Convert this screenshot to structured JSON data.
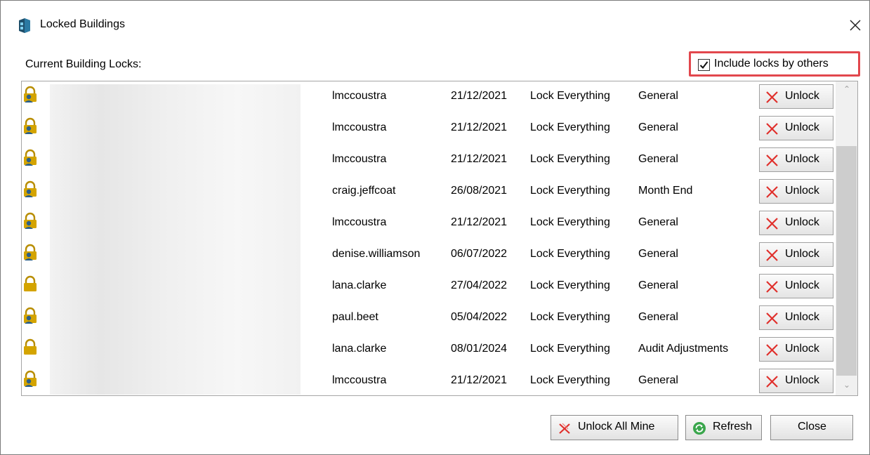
{
  "window": {
    "title": "Locked Buildings",
    "app_icon": "building-db-icon",
    "close_icon": "close-icon"
  },
  "section_label": "Current Building Locks:",
  "include_others": {
    "label": "Include locks by others",
    "checked": true,
    "highlight_color": "#e2474d"
  },
  "rows": [
    {
      "lock_icon": "lock-user-icon",
      "user": "lmccoustra",
      "date": "21/12/2021",
      "lock_type": "Lock Everything",
      "category": "General",
      "action": "Unlock"
    },
    {
      "lock_icon": "lock-user-icon",
      "user": "lmccoustra",
      "date": "21/12/2021",
      "lock_type": "Lock Everything",
      "category": "General",
      "action": "Unlock"
    },
    {
      "lock_icon": "lock-user-icon",
      "user": "lmccoustra",
      "date": "21/12/2021",
      "lock_type": "Lock Everything",
      "category": "General",
      "action": "Unlock"
    },
    {
      "lock_icon": "lock-user-icon",
      "user": "craig.jeffcoat",
      "date": "26/08/2021",
      "lock_type": "Lock Everything",
      "category": "Month End",
      "action": "Unlock"
    },
    {
      "lock_icon": "lock-user-icon",
      "user": "lmccoustra",
      "date": "21/12/2021",
      "lock_type": "Lock Everything",
      "category": "General",
      "action": "Unlock"
    },
    {
      "lock_icon": "lock-user-icon",
      "user": "denise.williamson",
      "date": "06/07/2022",
      "lock_type": "Lock Everything",
      "category": "General",
      "action": "Unlock"
    },
    {
      "lock_icon": "lock-icon",
      "user": "lana.clarke",
      "date": "27/04/2022",
      "lock_type": "Lock Everything",
      "category": "General",
      "action": "Unlock"
    },
    {
      "lock_icon": "lock-user-icon",
      "user": "paul.beet",
      "date": "05/04/2022",
      "lock_type": "Lock Everything",
      "category": "General",
      "action": "Unlock"
    },
    {
      "lock_icon": "lock-icon",
      "user": "lana.clarke",
      "date": "08/01/2024",
      "lock_type": "Lock Everything",
      "category": "Audit Adjustments",
      "action": "Unlock"
    },
    {
      "lock_icon": "lock-user-icon",
      "user": "lmccoustra",
      "date": "21/12/2021",
      "lock_type": "Lock Everything",
      "category": "General",
      "action": "Unlock"
    }
  ],
  "buttons": {
    "unlock_all": {
      "label": "Unlock All Mine",
      "icon": "unlock-all-icon"
    },
    "refresh": {
      "label": "Refresh",
      "icon": "refresh-icon"
    },
    "close": {
      "label": "Close"
    }
  },
  "colors": {
    "lock_gold": "#d4a400",
    "unlock_red": "#e0302c",
    "refresh_green": "#3aa64c"
  }
}
